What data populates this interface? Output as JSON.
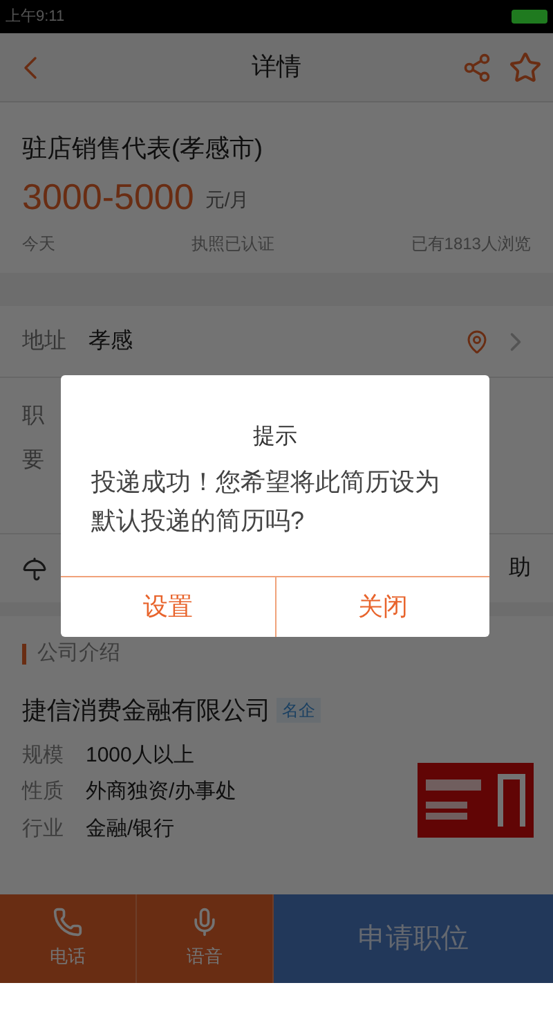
{
  "status_bar": {
    "time": "上午9:11"
  },
  "header": {
    "title": "详情"
  },
  "job": {
    "title": "驻店销售代表(孝感市)",
    "salary": "3000-5000",
    "salary_unit": "元/月",
    "posted": "今天",
    "license": "执照已认证",
    "views": "已有1813人浏览"
  },
  "address": {
    "label": "地址",
    "value": "孝感"
  },
  "partial_rows": [
    {
      "left": "职",
      "right": ""
    },
    {
      "left": "要",
      "right": ""
    },
    {
      "left": "",
      "right": "助"
    }
  ],
  "company": {
    "section_title": "公司介绍",
    "name": "捷信消费金融有限公司",
    "tag": "名企",
    "facts": [
      {
        "label": "规模",
        "value": "1000人以上"
      },
      {
        "label": "性质",
        "value": "外商独资/办事处"
      },
      {
        "label": "行业",
        "value": "金融/银行"
      }
    ]
  },
  "bottom_bar": {
    "actions": [
      {
        "kind": "phone",
        "label": "电话"
      },
      {
        "kind": "voice",
        "label": "语音"
      }
    ],
    "apply": "申请职位"
  },
  "dialog": {
    "title": "提示",
    "message": "投递成功！您希望将此简历设为默认投递的简历吗?",
    "buttons": [
      "设置",
      "关闭"
    ]
  }
}
